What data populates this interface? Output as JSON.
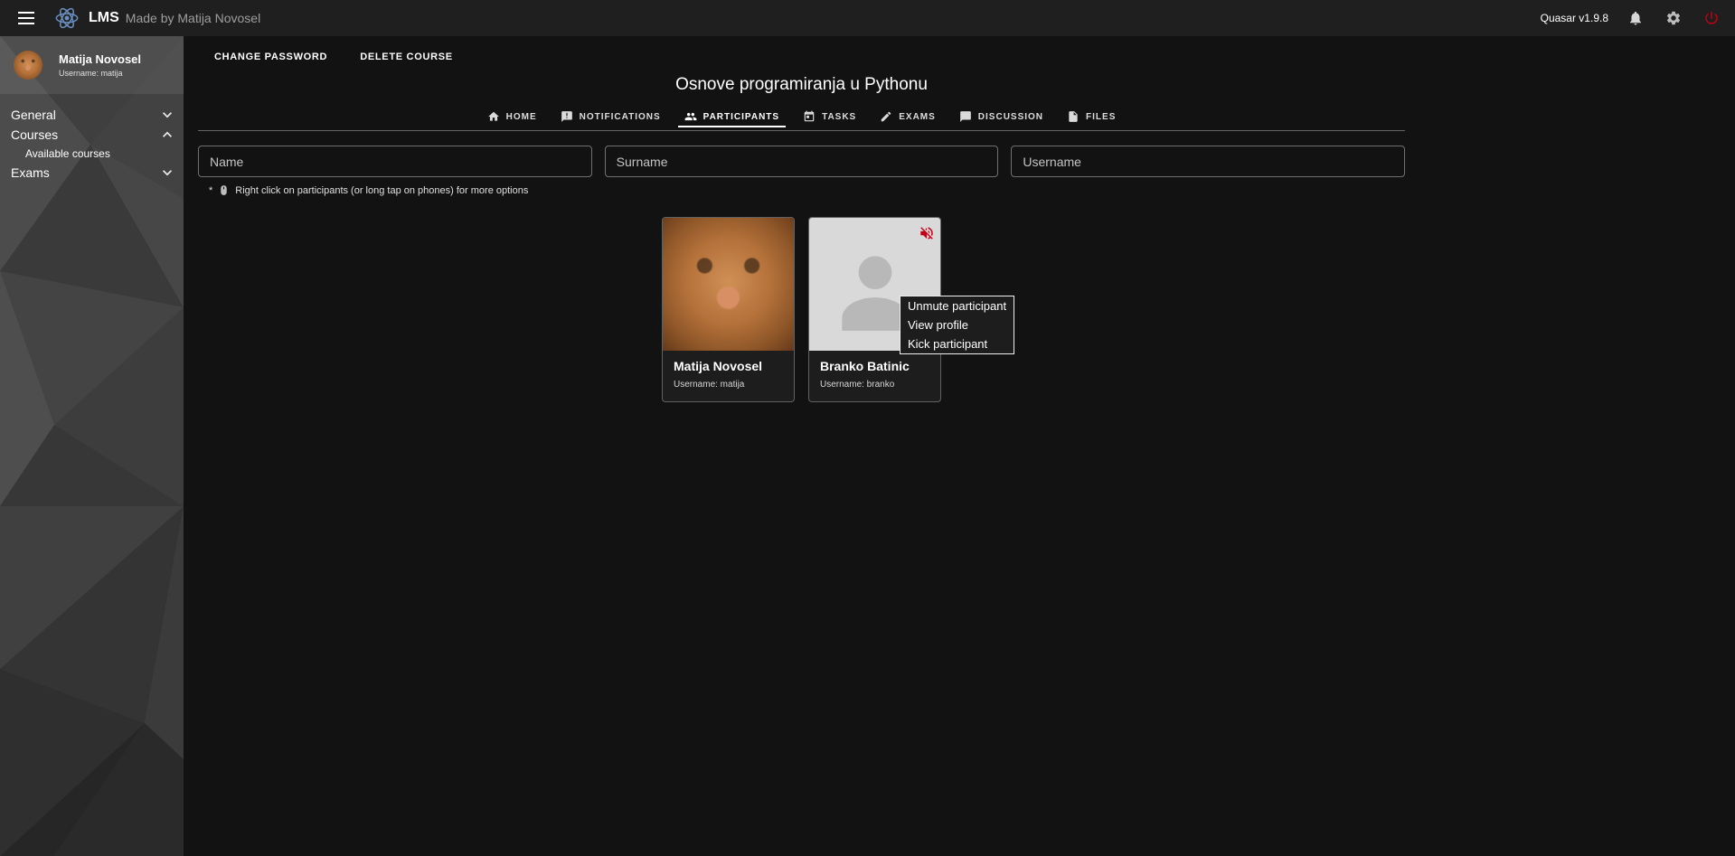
{
  "topbar": {
    "app_name": "LMS",
    "app_subtitle": "Made by Matija Novosel",
    "version_label": "Quasar v1.9.8"
  },
  "sidebar": {
    "profile": {
      "name": "Matija Novosel",
      "username": "Username: matija"
    },
    "items": [
      {
        "label": "General"
      },
      {
        "label": "Courses"
      },
      {
        "label": "Available courses"
      },
      {
        "label": "Exams"
      }
    ]
  },
  "toolbar": {
    "change_password_label": "CHANGE PASSWORD",
    "delete_course_label": "DELETE COURSE"
  },
  "course": {
    "title": "Osnove programiranja u Pythonu"
  },
  "tabs": [
    {
      "label": "HOME"
    },
    {
      "label": "NOTIFICATIONS"
    },
    {
      "label": "PARTICIPANTS"
    },
    {
      "label": "TASKS"
    },
    {
      "label": "EXAMS"
    },
    {
      "label": "DISCUSSION"
    },
    {
      "label": "FILES"
    }
  ],
  "filters": {
    "name_placeholder": "Name",
    "surname_placeholder": "Surname",
    "username_placeholder": "Username"
  },
  "hint": {
    "prefix": "*",
    "text": "Right click on participants (or long tap on phones) for more options"
  },
  "participants": [
    {
      "name": "Matija Novosel",
      "username": "Username: matija"
    },
    {
      "name": "Branko Batinic",
      "username": "Username: branko"
    }
  ],
  "context_menu": {
    "items": [
      {
        "label": "Unmute participant"
      },
      {
        "label": "View profile"
      },
      {
        "label": "Kick participant"
      }
    ]
  },
  "colors": {
    "accent_red": "#c10015",
    "logo_blue": "#6a8fc0"
  }
}
